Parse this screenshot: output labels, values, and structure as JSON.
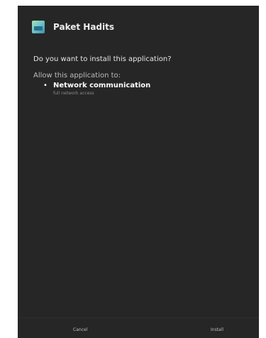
{
  "app": {
    "name": "Paket Hadits",
    "icon": "app-launcher-icon"
  },
  "prompt": {
    "question": "Do you want to install this application?",
    "allow_label": "Allow this application to:",
    "permissions": [
      {
        "title": "Network communication",
        "description": "full network access"
      }
    ]
  },
  "buttons": {
    "cancel": "Cancel",
    "install": "Install"
  },
  "colors": {
    "background": "#262626",
    "text": "#d8d8d8",
    "accent_icon": "#72c7c7"
  }
}
